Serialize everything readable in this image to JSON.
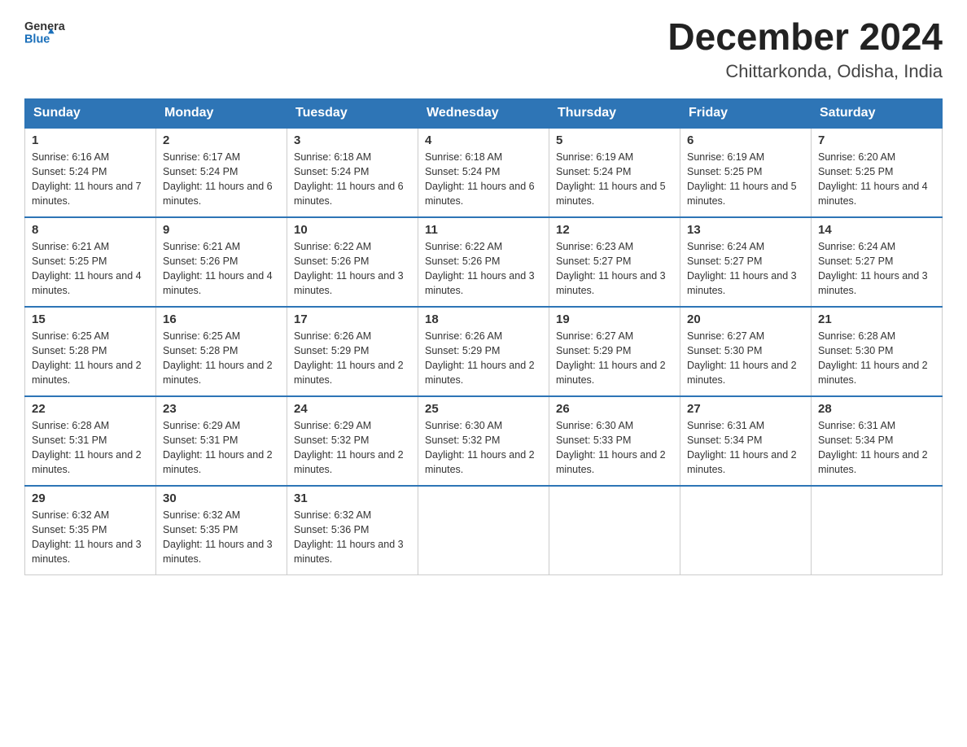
{
  "logo": {
    "text_general": "General",
    "text_blue": "Blue"
  },
  "title": "December 2024",
  "subtitle": "Chittarkonda, Odisha, India",
  "days_of_week": [
    "Sunday",
    "Monday",
    "Tuesday",
    "Wednesday",
    "Thursday",
    "Friday",
    "Saturday"
  ],
  "weeks": [
    [
      {
        "day": "1",
        "sunrise": "6:16 AM",
        "sunset": "5:24 PM",
        "daylight": "11 hours and 7 minutes."
      },
      {
        "day": "2",
        "sunrise": "6:17 AM",
        "sunset": "5:24 PM",
        "daylight": "11 hours and 6 minutes."
      },
      {
        "day": "3",
        "sunrise": "6:18 AM",
        "sunset": "5:24 PM",
        "daylight": "11 hours and 6 minutes."
      },
      {
        "day": "4",
        "sunrise": "6:18 AM",
        "sunset": "5:24 PM",
        "daylight": "11 hours and 6 minutes."
      },
      {
        "day": "5",
        "sunrise": "6:19 AM",
        "sunset": "5:24 PM",
        "daylight": "11 hours and 5 minutes."
      },
      {
        "day": "6",
        "sunrise": "6:19 AM",
        "sunset": "5:25 PM",
        "daylight": "11 hours and 5 minutes."
      },
      {
        "day": "7",
        "sunrise": "6:20 AM",
        "sunset": "5:25 PM",
        "daylight": "11 hours and 4 minutes."
      }
    ],
    [
      {
        "day": "8",
        "sunrise": "6:21 AM",
        "sunset": "5:25 PM",
        "daylight": "11 hours and 4 minutes."
      },
      {
        "day": "9",
        "sunrise": "6:21 AM",
        "sunset": "5:26 PM",
        "daylight": "11 hours and 4 minutes."
      },
      {
        "day": "10",
        "sunrise": "6:22 AM",
        "sunset": "5:26 PM",
        "daylight": "11 hours and 3 minutes."
      },
      {
        "day": "11",
        "sunrise": "6:22 AM",
        "sunset": "5:26 PM",
        "daylight": "11 hours and 3 minutes."
      },
      {
        "day": "12",
        "sunrise": "6:23 AM",
        "sunset": "5:27 PM",
        "daylight": "11 hours and 3 minutes."
      },
      {
        "day": "13",
        "sunrise": "6:24 AM",
        "sunset": "5:27 PM",
        "daylight": "11 hours and 3 minutes."
      },
      {
        "day": "14",
        "sunrise": "6:24 AM",
        "sunset": "5:27 PM",
        "daylight": "11 hours and 3 minutes."
      }
    ],
    [
      {
        "day": "15",
        "sunrise": "6:25 AM",
        "sunset": "5:28 PM",
        "daylight": "11 hours and 2 minutes."
      },
      {
        "day": "16",
        "sunrise": "6:25 AM",
        "sunset": "5:28 PM",
        "daylight": "11 hours and 2 minutes."
      },
      {
        "day": "17",
        "sunrise": "6:26 AM",
        "sunset": "5:29 PM",
        "daylight": "11 hours and 2 minutes."
      },
      {
        "day": "18",
        "sunrise": "6:26 AM",
        "sunset": "5:29 PM",
        "daylight": "11 hours and 2 minutes."
      },
      {
        "day": "19",
        "sunrise": "6:27 AM",
        "sunset": "5:29 PM",
        "daylight": "11 hours and 2 minutes."
      },
      {
        "day": "20",
        "sunrise": "6:27 AM",
        "sunset": "5:30 PM",
        "daylight": "11 hours and 2 minutes."
      },
      {
        "day": "21",
        "sunrise": "6:28 AM",
        "sunset": "5:30 PM",
        "daylight": "11 hours and 2 minutes."
      }
    ],
    [
      {
        "day": "22",
        "sunrise": "6:28 AM",
        "sunset": "5:31 PM",
        "daylight": "11 hours and 2 minutes."
      },
      {
        "day": "23",
        "sunrise": "6:29 AM",
        "sunset": "5:31 PM",
        "daylight": "11 hours and 2 minutes."
      },
      {
        "day": "24",
        "sunrise": "6:29 AM",
        "sunset": "5:32 PM",
        "daylight": "11 hours and 2 minutes."
      },
      {
        "day": "25",
        "sunrise": "6:30 AM",
        "sunset": "5:32 PM",
        "daylight": "11 hours and 2 minutes."
      },
      {
        "day": "26",
        "sunrise": "6:30 AM",
        "sunset": "5:33 PM",
        "daylight": "11 hours and 2 minutes."
      },
      {
        "day": "27",
        "sunrise": "6:31 AM",
        "sunset": "5:34 PM",
        "daylight": "11 hours and 2 minutes."
      },
      {
        "day": "28",
        "sunrise": "6:31 AM",
        "sunset": "5:34 PM",
        "daylight": "11 hours and 2 minutes."
      }
    ],
    [
      {
        "day": "29",
        "sunrise": "6:32 AM",
        "sunset": "5:35 PM",
        "daylight": "11 hours and 3 minutes."
      },
      {
        "day": "30",
        "sunrise": "6:32 AM",
        "sunset": "5:35 PM",
        "daylight": "11 hours and 3 minutes."
      },
      {
        "day": "31",
        "sunrise": "6:32 AM",
        "sunset": "5:36 PM",
        "daylight": "11 hours and 3 minutes."
      },
      null,
      null,
      null,
      null
    ]
  ]
}
